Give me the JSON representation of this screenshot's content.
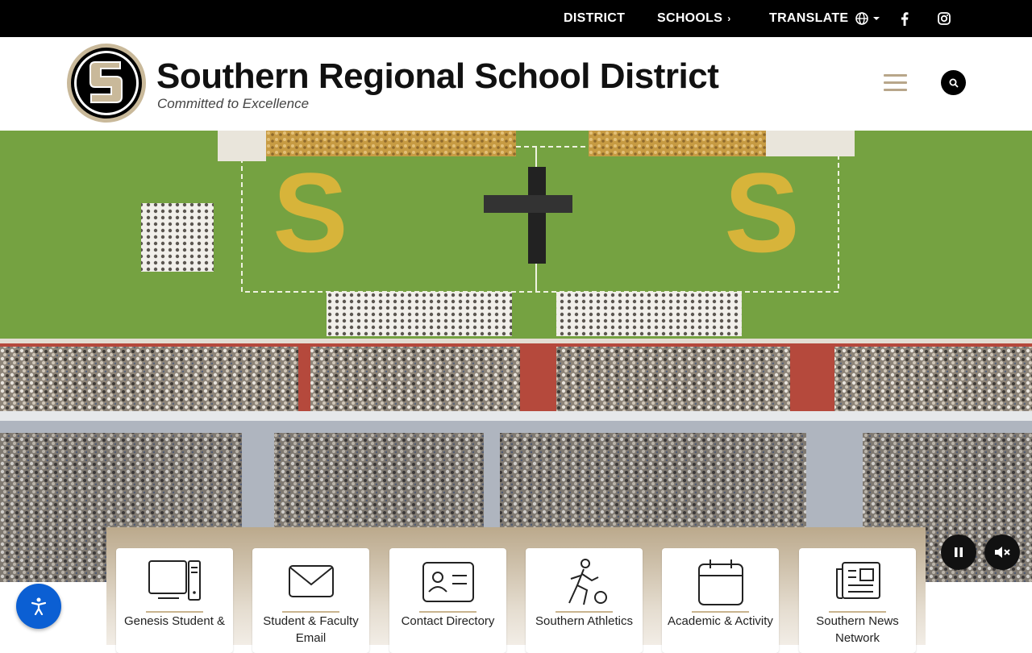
{
  "topbar": {
    "district": "DISTRICT",
    "schools": "SCHOOLS",
    "translate": "TRANSLATE"
  },
  "header": {
    "title": "Southern Regional School District",
    "tagline": "Committed to Excellence",
    "logo_letter": "S"
  },
  "quick_links": [
    {
      "label": "Genesis Student &",
      "icon": "computer-icon"
    },
    {
      "label": "Student & Faculty Email",
      "icon": "envelope-icon"
    },
    {
      "label": "Contact Directory",
      "icon": "contact-card-icon"
    },
    {
      "label": "Southern Athletics",
      "icon": "athlete-icon"
    },
    {
      "label": "Academic & Activity",
      "icon": "calendar-icon"
    },
    {
      "label": "Southern News Network",
      "icon": "newspaper-icon"
    }
  ],
  "colors": {
    "brand_gold": "#b8a68a",
    "accessibility_blue": "#0b5fd3"
  }
}
